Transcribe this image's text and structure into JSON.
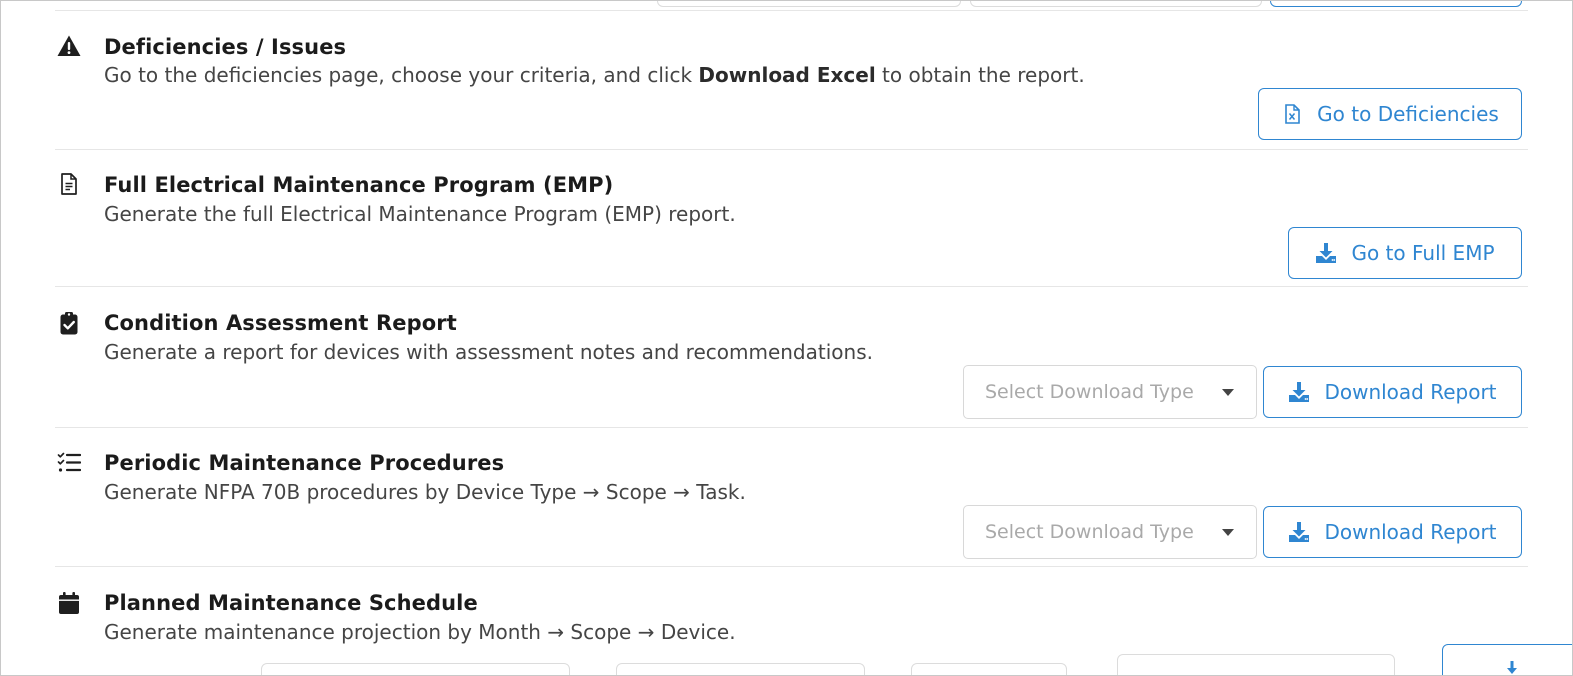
{
  "sections": [
    {
      "title": "Deficiencies / Issues",
      "description_prefix": "Go to the deficiencies page, choose your criteria, and click ",
      "description_bold": "Download Excel",
      "description_suffix": " to obtain the report.",
      "icon": "warning-triangle-icon",
      "button_label": "Go to Deficiencies",
      "button_icon": "excel-file-icon"
    },
    {
      "title": "Full Electrical Maintenance Program (EMP)",
      "description": "Generate the full Electrical Maintenance Program (EMP) report.",
      "icon": "document-icon",
      "button_label": "Go to Full EMP",
      "button_icon": "download-icon"
    },
    {
      "title": "Condition Assessment Report",
      "description": "Generate a report for devices with assessment notes and recommendations.",
      "icon": "clipboard-check-icon",
      "select_placeholder": "Select Download Type",
      "button_label": "Download Report",
      "button_icon": "download-icon"
    },
    {
      "title": "Periodic Maintenance Procedures",
      "description": "Generate NFPA 70B procedures by Device Type → Scope → Task.",
      "icon": "checklist-icon",
      "select_placeholder": "Select Download Type",
      "button_label": "Download Report",
      "button_icon": "download-icon"
    },
    {
      "title": "Planned Maintenance Schedule",
      "description": "Generate maintenance projection by Month → Scope → Device.",
      "icon": "calendar-icon"
    }
  ],
  "colors": {
    "accent": "#2f86d1",
    "text": "#1b1b1b",
    "muted": "#454545",
    "placeholder": "#a9a9a9",
    "divider": "#e6e6e6"
  }
}
